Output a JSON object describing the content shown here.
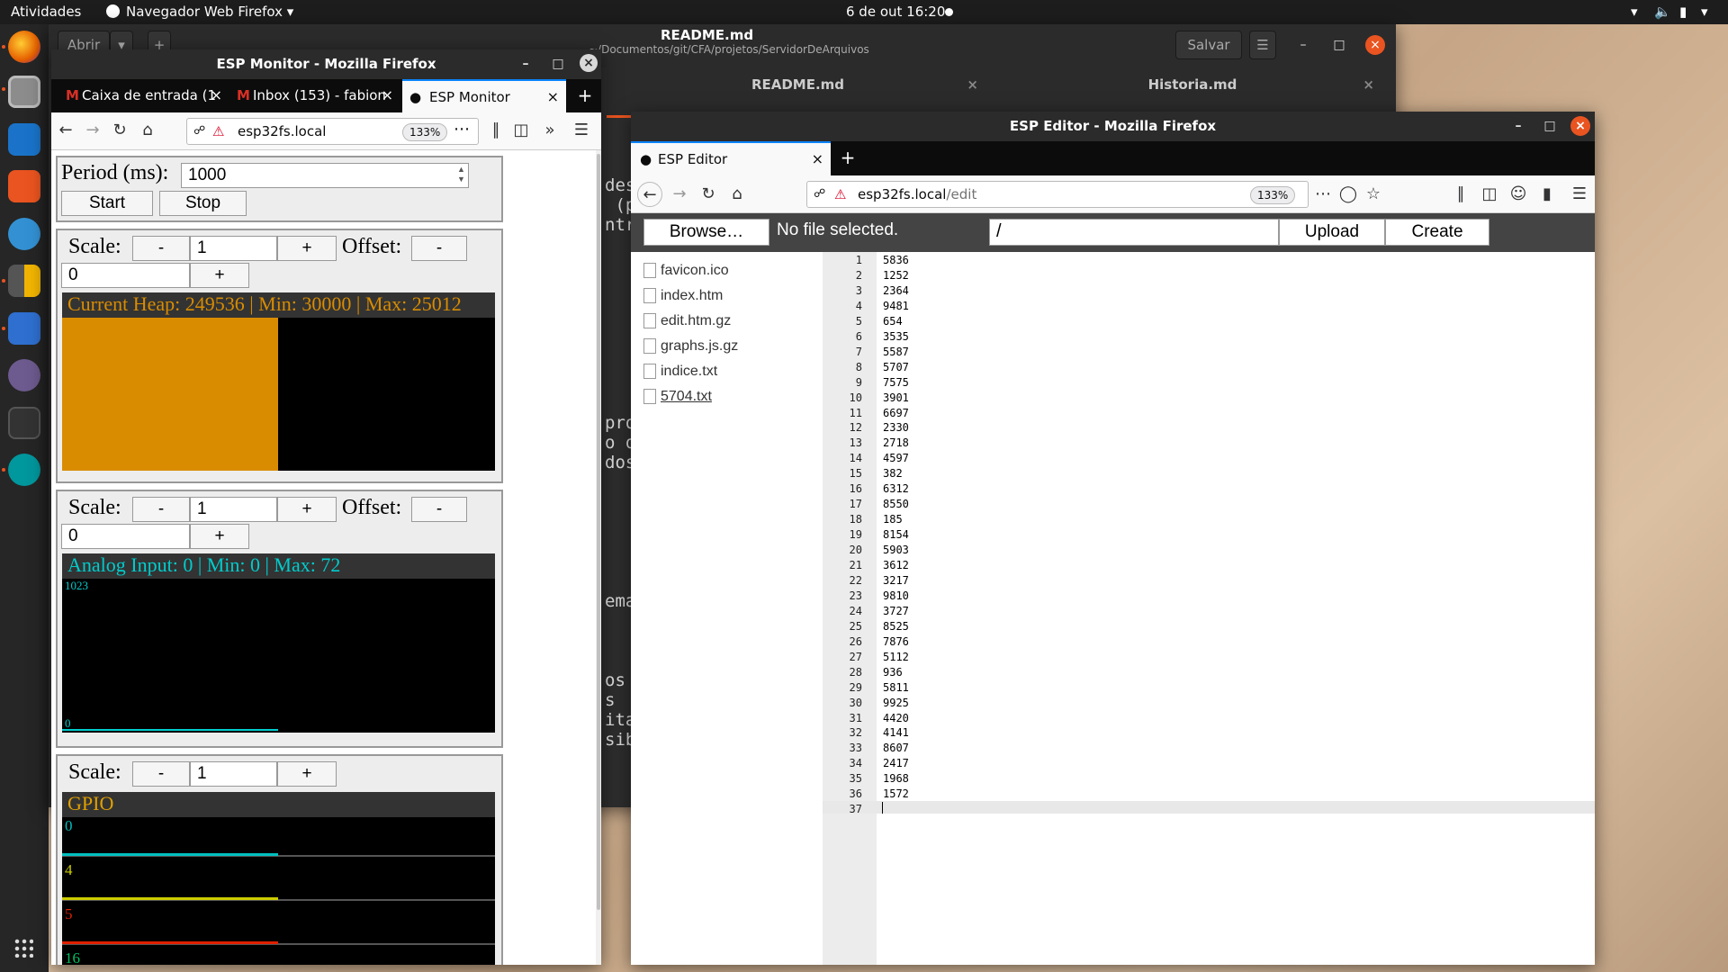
{
  "topbar": {
    "activities": "Atividades",
    "app_menu": "Navegador Web Firefox ▾",
    "clock": "6 de out  16:20"
  },
  "dock": {
    "icons": [
      "firefox-icon",
      "files-icon",
      "writer-icon",
      "software-center-icon",
      "help-icon",
      "calculator-icon",
      "text-editor-icon",
      "screenshot-icon",
      "terminal-icon",
      "arduino-icon"
    ],
    "show_apps": "show-applications-icon"
  },
  "gedit": {
    "open_label": "Abrir",
    "title": "README.md",
    "path": "~/Documentos/git/CFA/projetos/ServidorDeArquivos",
    "save_label": "Salvar",
    "tabs": [
      "README.md",
      "Historia.md"
    ],
    "visible_text": [
      "des",
      " (p",
      "ntr",
      "",
      "",
      "",
      "",
      "",
      "pro",
      "o q",
      "dos",
      "",
      "",
      "ema",
      "",
      "os",
      "s",
      "ita",
      "sib"
    ]
  },
  "monitor_window": {
    "title": "ESP Monitor - Mozilla Firefox",
    "tabs": [
      {
        "label": "Caixa de entrada (1"
      },
      {
        "label": "Inbox (153) - fabion"
      },
      {
        "label": "ESP Monitor"
      }
    ],
    "url": "esp32fs.local",
    "zoom": "133%",
    "period_label": "Period (ms):",
    "period_value": "1000",
    "start_label": "Start",
    "stop_label": "Stop",
    "scale_label": "Scale:",
    "offset_label": "Offset:",
    "minus": "-",
    "plus": "+",
    "scale_value": "1",
    "offset_value": "0",
    "heap": {
      "header": "Current Heap: 249536 | Min: 30000 | Max: 25012",
      "ymax": "30000",
      "ymin": "0",
      "color": "#d98c00"
    },
    "analog": {
      "header": "Analog Input: 0 | Min: 0 | Max: 72",
      "ymax": "1023",
      "ymin": "0",
      "color": "#00cccc"
    },
    "gpio": {
      "header": "GPIO",
      "pins": [
        {
          "label": "0",
          "color": "#00bfbf"
        },
        {
          "label": "4",
          "color": "#cccc00"
        },
        {
          "label": "5",
          "color": "#e02000"
        },
        {
          "label": "16",
          "color": "#00c060"
        }
      ]
    }
  },
  "editor_window": {
    "title": "ESP Editor - Mozilla Firefox",
    "tab_label": "ESP Editor",
    "url_host": "esp32fs.local",
    "url_path": "/edit",
    "zoom": "133%",
    "browse_label": "Browse…",
    "no_file": "No file selected.",
    "path_value": "/",
    "upload_label": "Upload",
    "create_label": "Create",
    "files": [
      "favicon.ico",
      "index.htm",
      "edit.htm.gz",
      "graphs.js.gz",
      "indice.txt",
      "5704.txt"
    ],
    "lines": [
      "5836",
      "1252",
      "2364",
      "9481",
      "654",
      "3535",
      "5587",
      "5707",
      "7575",
      "3901",
      "6697",
      "2330",
      "2718",
      "4597",
      "382",
      "6312",
      "8550",
      "185",
      "8154",
      "5903",
      "3612",
      "3217",
      "9810",
      "3727",
      "8525",
      "7876",
      "5112",
      "936",
      "5811",
      "9925",
      "4420",
      "4141",
      "8607",
      "2417",
      "1968",
      "1572",
      ""
    ]
  }
}
